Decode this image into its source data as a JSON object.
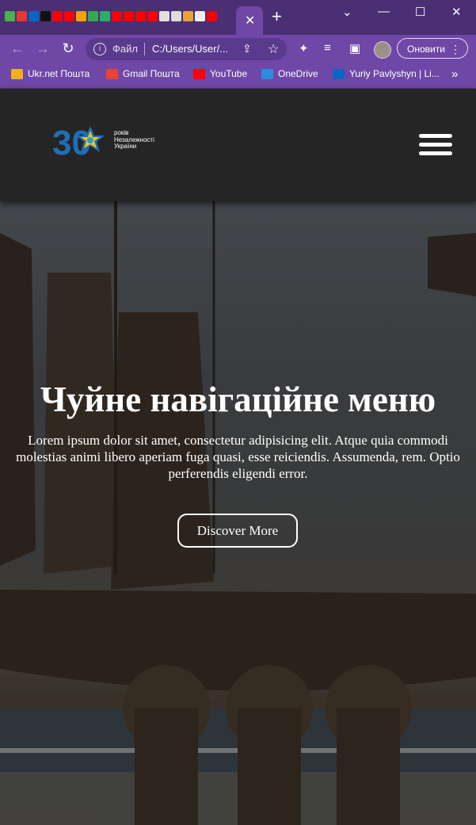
{
  "browser": {
    "tab_close": "✕",
    "new_tab": "+",
    "window_controls": {
      "dropdown": "⌄",
      "minimize": "—",
      "maximize": "☐",
      "close": "✕"
    },
    "omnibox": {
      "scheme_label": "Файл",
      "url": "C:/Users/User/..."
    },
    "update_button_label": "Оновити",
    "bookmarks": [
      {
        "label": "Ukr.net Пошта",
        "icon": "ukrnet-icon",
        "color": "#f0b020"
      },
      {
        "label": "Gmail Пошта",
        "icon": "gmail-icon",
        "color": "#ea4335"
      },
      {
        "label": "YouTube",
        "icon": "youtube-icon",
        "color": "#ff0000"
      },
      {
        "label": "OneDrive",
        "icon": "onedrive-icon",
        "color": "#2a8de0"
      },
      {
        "label": "Yuriy Pavlyshyn | Li...",
        "icon": "linkedin-icon",
        "color": "#0a66c2"
      }
    ],
    "bookmarks_more": "»"
  },
  "site": {
    "logo": {
      "number": "30",
      "line1": "років",
      "line2": "Незалежності",
      "line3": "України"
    }
  },
  "hero": {
    "title": "Чуйне навігаційне меню",
    "text": "Lorem ipsum dolor sit amet, consectetur adipisicing elit. Atque quia commodi molestias animi libero aperiam fuga quasi, esse reiciendis. Assumenda, rem. Optio perferendis eligendi error.",
    "button": "Discover More"
  },
  "colors": {
    "tabstrip": "#4a2f74",
    "toolbar": "#6f47a6",
    "header": "#252525",
    "logo_blue": "#1f6fb5",
    "logo_yellow": "#f5c21b"
  }
}
